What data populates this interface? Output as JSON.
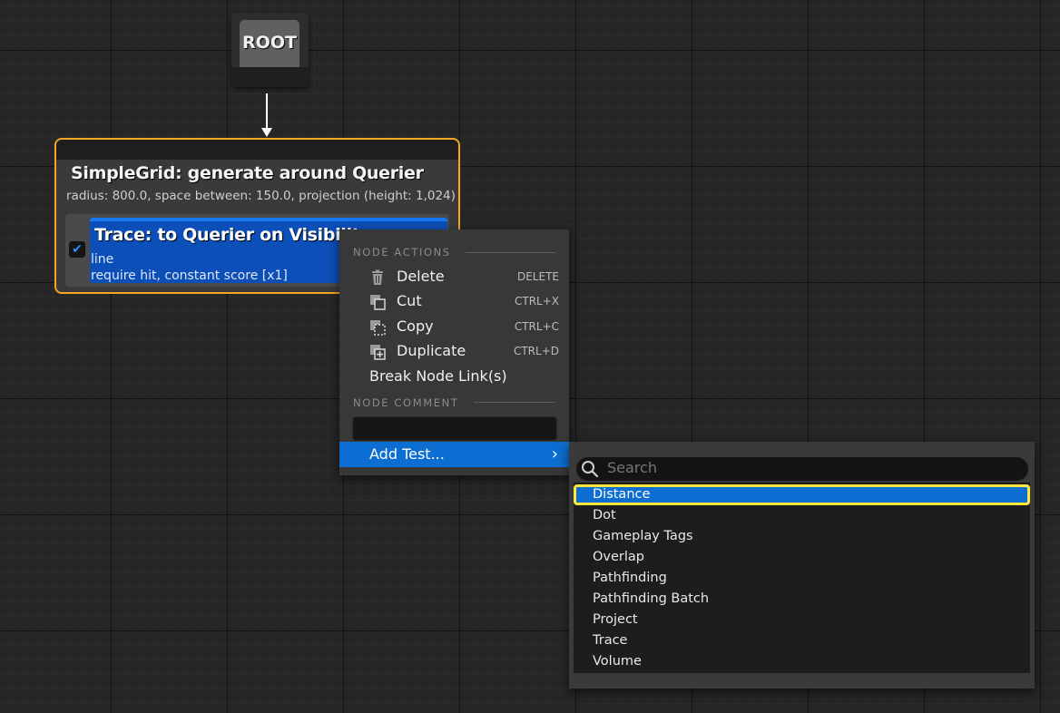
{
  "graph": {
    "root": {
      "label": "ROOT"
    },
    "generator": {
      "title": "SimpleGrid: generate around Querier",
      "description": "radius: 800.0, space between: 150.0, projection (height: 1,024)",
      "test": {
        "enabled_mark": "✔",
        "title": "Trace: to Querier on Visibility",
        "line1": "line",
        "line2": "require hit, constant score [x1]"
      }
    }
  },
  "context_menu": {
    "node_actions_heading": "NODE ACTIONS",
    "items": [
      {
        "label": "Delete",
        "shortcut": "DELETE",
        "icon": "trash-icon"
      },
      {
        "label": "Cut",
        "shortcut": "CTRL+X",
        "icon": "cut-icon"
      },
      {
        "label": "Copy",
        "shortcut": "CTRL+C",
        "icon": "copy-icon"
      },
      {
        "label": "Duplicate",
        "shortcut": "CTRL+D",
        "icon": "duplicate-icon"
      },
      {
        "label": "Break Node Link(s)",
        "shortcut": "",
        "icon": ""
      }
    ],
    "node_comment_heading": "NODE COMMENT",
    "comment_value": "",
    "add_test_label": "Add Test...",
    "add_test_arrow": "›"
  },
  "add_test_submenu": {
    "search_placeholder": "Search",
    "items": [
      "Distance",
      "Dot",
      "Gameplay Tags",
      "Overlap",
      "Pathfinding",
      "Pathfinding Batch",
      "Project",
      "Trace",
      "Volume"
    ],
    "selected": "Distance"
  },
  "colors": {
    "selection_outline": "#f5a623",
    "test_node": "#0d4fb8",
    "menu_highlight": "#0c6ed2",
    "focus_ring": "#ffe83a"
  }
}
